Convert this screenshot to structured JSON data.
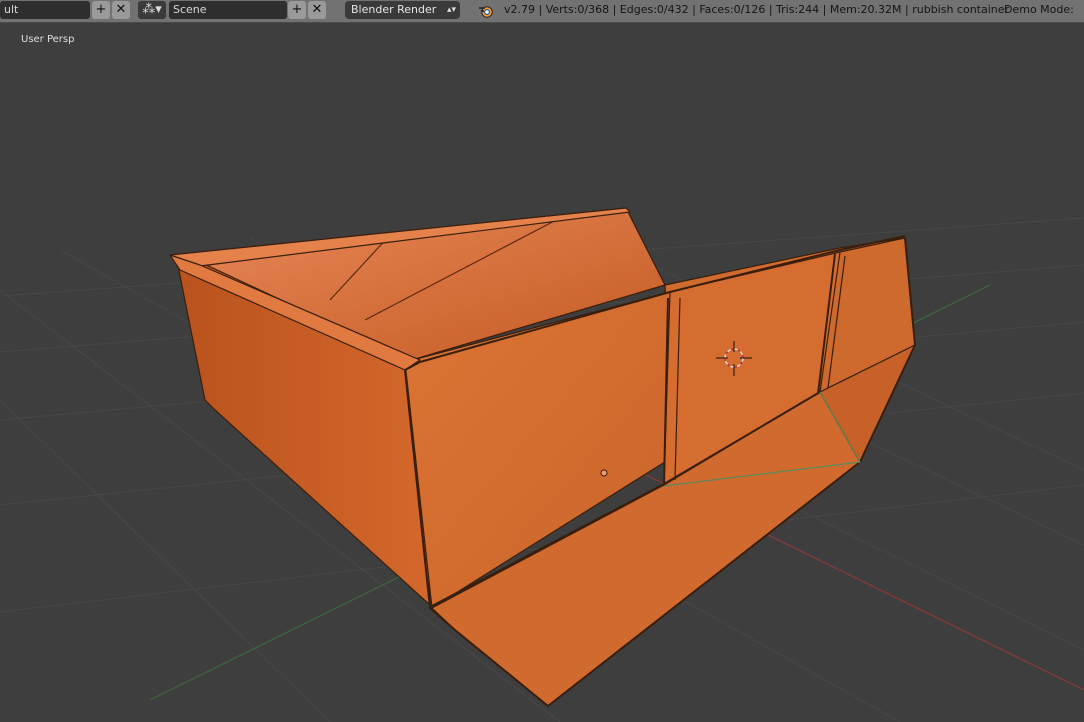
{
  "header": {
    "layout_field": "ult",
    "scene_field": "Scene",
    "render_engine": "Blender Render",
    "stats": "v2.79 | Verts:0/368 | Edges:0/432 | Faces:0/126 | Tris:244 | Mem:20.32M | rubbish container",
    "demo_mode": "Demo Mode:",
    "add_icon": "plus-icon",
    "close_icon": "x-icon",
    "scene_icon": "scene-icon",
    "logo_icon": "blender-logo-icon"
  },
  "viewport": {
    "view_label": "User Persp",
    "object_name": "rubbish container",
    "object_color": "#d8692c",
    "background_color": "#3d3d3d",
    "grid_color": "#474747",
    "x_axis_color": "#8a3a3a",
    "y_axis_color": "#3d6a3d"
  }
}
